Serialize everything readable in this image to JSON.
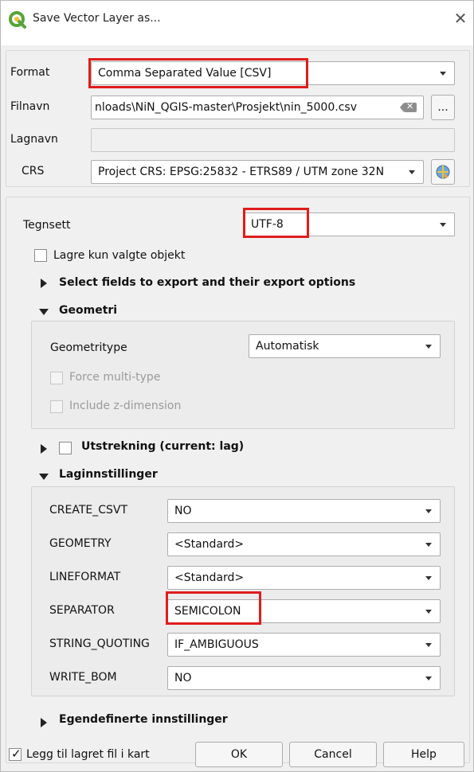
{
  "window": {
    "title": "Save Vector Layer as...",
    "close_glyph": "✕"
  },
  "top": {
    "format_label": "Format",
    "format_value": "Comma Separated Value [CSV]",
    "filename_label": "Filnavn",
    "filename_value": "nloads\\NiN_QGIS-master\\Prosjekt\\nin_5000.csv",
    "browse_label": "...",
    "layername_label": "Lagnavn",
    "layername_value": "",
    "crs_label": "CRS",
    "crs_value": "Project CRS: EPSG:25832 - ETRS89 / UTM zone 32N"
  },
  "encoding": {
    "label": "Tegnsett",
    "value": "UTF-8",
    "only_selected_label": "Lagre kun valgte objekt"
  },
  "sections": {
    "select_fields": "Select fields to export and their export options",
    "geometry": "Geometri",
    "extent": "Utstrekning (current: lag)",
    "layer_options": "Laginnstillinger",
    "custom_options": "Egendefinerte innstillinger"
  },
  "geometry": {
    "type_label": "Geometritype",
    "type_value": "Automatisk",
    "force_multi_label": "Force multi-type",
    "z_dim_label": "Include z-dimension"
  },
  "layer_options": [
    {
      "key": "CREATE_CSVT",
      "value": "NO"
    },
    {
      "key": "GEOMETRY",
      "value": "<Standard>"
    },
    {
      "key": "LINEFORMAT",
      "value": "<Standard>"
    },
    {
      "key": "SEPARATOR",
      "value": "SEMICOLON"
    },
    {
      "key": "STRING_QUOTING",
      "value": "IF_AMBIGUOUS"
    },
    {
      "key": "WRITE_BOM",
      "value": "NO"
    }
  ],
  "footer": {
    "add_to_map_label": "Legg til lagret fil i kart",
    "add_to_map_checked": true,
    "ok_label": "OK",
    "cancel_label": "Cancel",
    "help_label": "Help"
  },
  "colors": {
    "highlight": "#e01c1c",
    "qgis_green": "#58a33a"
  }
}
